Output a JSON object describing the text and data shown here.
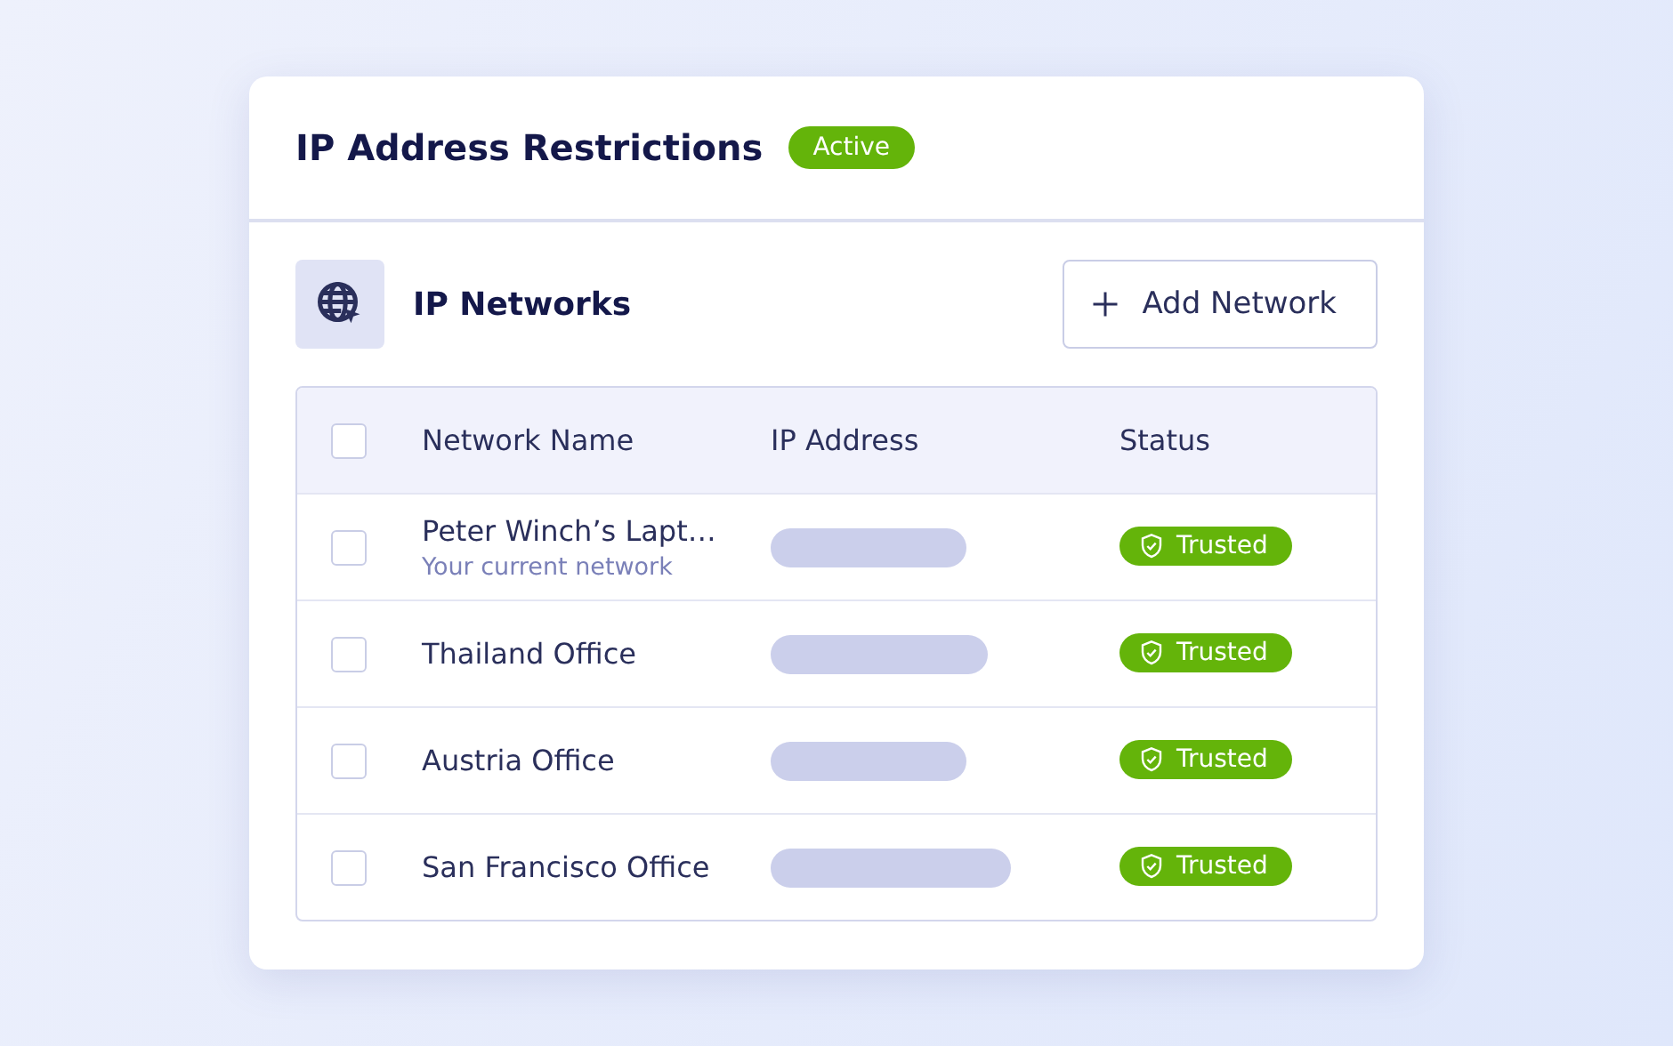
{
  "card": {
    "title": "IP Address Restrictions",
    "badge": "Active"
  },
  "section": {
    "title": "IP Networks",
    "button": "Add Network"
  },
  "table": {
    "select_all": {
      "checked": false
    },
    "columns": [
      "Network Name",
      "IP Address",
      "Status"
    ],
    "rows": [
      {
        "checked": false,
        "name": "Peter Winch’s Lapt…",
        "note": "Your current network",
        "status": "Trusted"
      },
      {
        "checked": false,
        "name": "Thailand Office",
        "status": "Trusted"
      },
      {
        "checked": false,
        "name": "Austria Office",
        "status": "Trusted"
      },
      {
        "checked": false,
        "name": "San Francisco Office",
        "status": "Trusted"
      }
    ]
  }
}
